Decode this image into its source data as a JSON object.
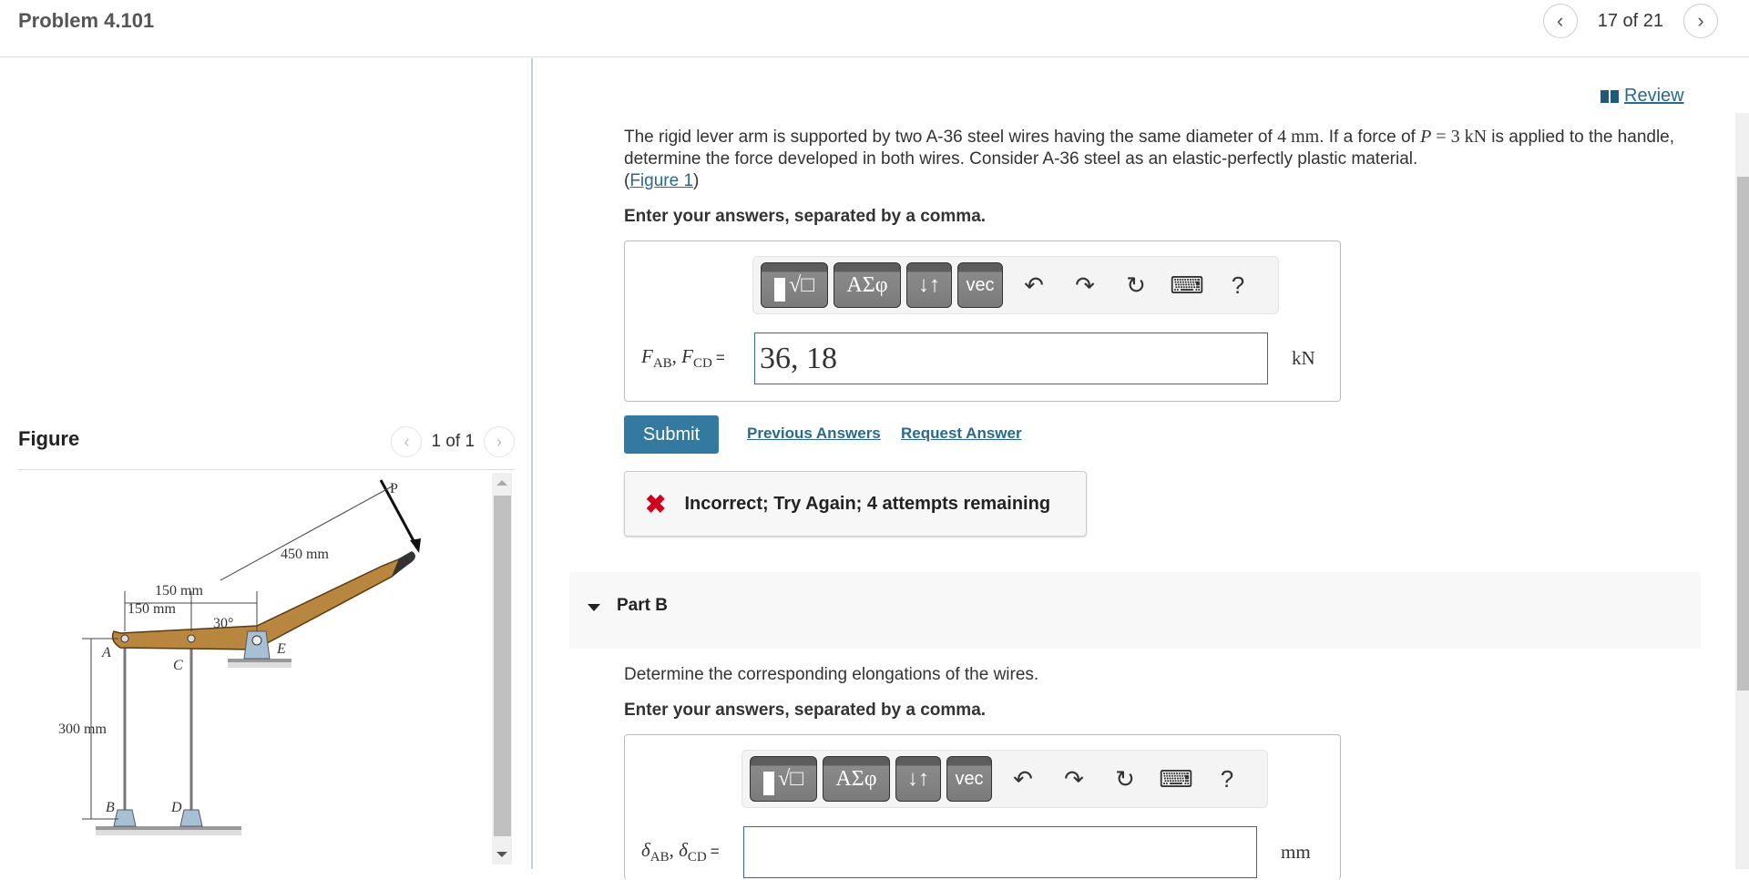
{
  "header": {
    "title": "Problem 4.101",
    "pager_text": "17 of 21",
    "prev_icon": "chevron-left-icon",
    "next_icon": "chevron-right-icon"
  },
  "figure_panel": {
    "title": "Figure",
    "pager_text": "1 of 1",
    "labels": {
      "P": "P",
      "d450": "450 mm",
      "d150a": "150 mm",
      "d150b": "150 mm",
      "angle": "30°",
      "A": "A",
      "B": "B",
      "C": "C",
      "D": "D",
      "E": "E",
      "d300": "300 mm"
    }
  },
  "review": {
    "label": "Review",
    "icon": "book-icon"
  },
  "problem": {
    "text_1": "The rigid lever arm is supported by two A-36 steel wires having the same diameter of ",
    "diameter": "4 mm",
    "text_2": ". If a force of ",
    "force_var": "P",
    "force_eq": " = 3 kN",
    "text_3": " is applied to the handle, determine the force developed in both wires. Consider A-36 steel as an elastic-perfectly plastic material.",
    "figure_link": "Figure 1"
  },
  "part_a": {
    "instruction": "Enter your answers, separated by a comma.",
    "toolbar": {
      "templates_icon": "templates-radical-icon",
      "greek_label": "ΑΣφ",
      "arrows_label": "↓↑",
      "vec_label": "vec",
      "undo_icon": "undo-icon",
      "redo_icon": "redo-icon",
      "reset_icon": "reset-icon",
      "keyboard_icon": "keyboard-icon",
      "help_label": "?"
    },
    "label_var1": "F",
    "label_sub1": "AB",
    "label_var2": "F",
    "label_sub2": "CD",
    "equals": "=",
    "input_value": "36, 18",
    "unit": "kN",
    "submit_label": "Submit",
    "previous_answers_label": "Previous Answers",
    "request_answer_label": "Request Answer",
    "feedback_text": "Incorrect; Try Again; 4 attempts remaining",
    "feedback_color": "#d0021b"
  },
  "part_b": {
    "title": "Part B",
    "question": "Determine the corresponding elongations of the wires.",
    "instruction": "Enter your answers, separated by a comma.",
    "toolbar": {
      "greek_label": "ΑΣφ",
      "arrows_label": "↓↑",
      "vec_label": "vec",
      "help_label": "?"
    },
    "label_var1": "δ",
    "label_sub1": "AB",
    "label_var2": "δ",
    "label_sub2": "CD",
    "equals": "=",
    "input_value": "",
    "unit": "mm"
  },
  "colors": {
    "accent": "#347aa0",
    "link": "#2a6a8c",
    "error": "#d0021b"
  }
}
